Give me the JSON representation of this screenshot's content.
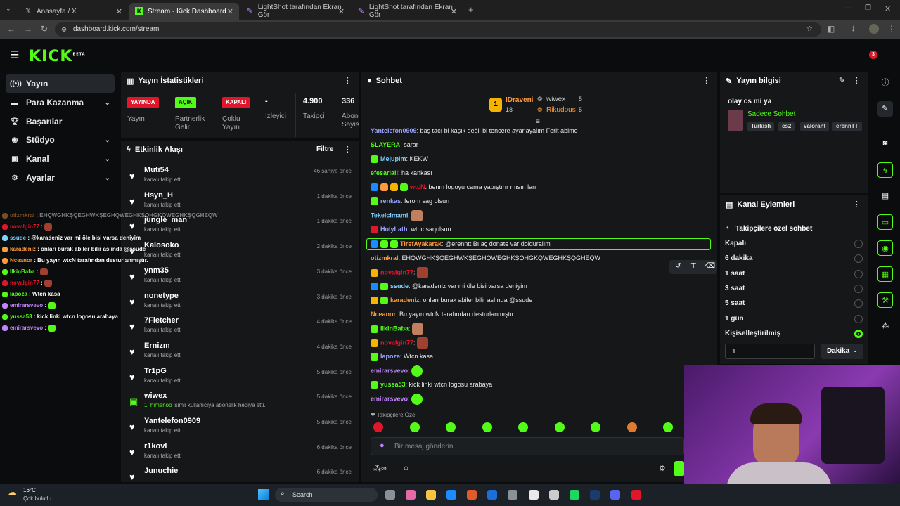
{
  "browser": {
    "tabs": [
      {
        "label": "Anasayfa / X",
        "icon": "x-logo-icon"
      },
      {
        "label": "Stream - Kick Dashboard",
        "icon": "kick-logo-icon"
      },
      {
        "label": "LightShot tarafından Ekran Gör",
        "icon": "lightshot-icon"
      },
      {
        "label": "LightShot tarafından Ekran Gör",
        "icon": "lightshot-icon"
      }
    ],
    "url": "dashboard.kick.com/stream"
  },
  "site": {
    "logo": "KICK",
    "logo_sup": "BETA",
    "notif_count": "3"
  },
  "nav": [
    {
      "label": "Yayın",
      "icon": "broadcast-icon"
    },
    {
      "label": "Para Kazanma",
      "icon": "money-icon"
    },
    {
      "label": "Başarılar",
      "icon": "trophy-icon"
    },
    {
      "label": "Stüdyo",
      "icon": "studio-icon"
    },
    {
      "label": "Kanal",
      "icon": "channel-icon"
    },
    {
      "label": "Ayarlar",
      "icon": "gear-icon"
    }
  ],
  "stats": {
    "title": "Yayın İstatistikleri",
    "badges": [
      {
        "label": "YAYINDA",
        "caption": "Yayın",
        "color": "#e2162b"
      },
      {
        "label": "AÇIK",
        "caption": "Partnerlik Gelir Programı",
        "color": "#53fc18"
      },
      {
        "label": "KAPALI",
        "caption": "Çoklu Yayın",
        "color": "#e2162b"
      }
    ],
    "numbers": [
      {
        "value": "-",
        "caption": "İzleyici"
      },
      {
        "value": "4.900",
        "caption": "Takipçi"
      },
      {
        "value": "336",
        "caption": "Abone Sayısı"
      }
    ]
  },
  "activity": {
    "title": "Etkinlik Akışı",
    "filter": "Filtre",
    "items": [
      {
        "name": "Muti54",
        "action": "kanalı takip etti",
        "time": "46 saniye önce",
        "type": "follow"
      },
      {
        "name": "Hsyn_H",
        "action": "kanalı takip etti",
        "time": "1 dakika önce",
        "type": "follow"
      },
      {
        "name": "jungle_man",
        "action": "kanalı takip etti",
        "time": "1 dakika önce",
        "type": "follow"
      },
      {
        "name": "Kalosoko",
        "action": "kanalı takip etti",
        "time": "2 dakika önce",
        "type": "follow"
      },
      {
        "name": "ynm35",
        "action": "kanalı takip etti",
        "time": "3 dakika önce",
        "type": "follow"
      },
      {
        "name": "nonetype",
        "action": "kanalı takip etti",
        "time": "3 dakika önce",
        "type": "follow"
      },
      {
        "name": "7Fletcher",
        "action": "kanalı takip etti",
        "time": "4 dakika önce",
        "type": "follow"
      },
      {
        "name": "Ernizm",
        "action": "kanalı takip etti",
        "time": "4 dakika önce",
        "type": "follow"
      },
      {
        "name": "Tr1pG",
        "action": "kanalı takip etti",
        "time": "5 dakika önce",
        "type": "follow"
      },
      {
        "name": "wiwex",
        "action": "isimli kullanıcıya abonelik hediye etti.",
        "highlight": "1, himenoo",
        "time": "5 dakika önce",
        "type": "gift"
      },
      {
        "name": "Yantelefon0909",
        "action": "kanalı takip etti",
        "time": "5 dakika önce",
        "type": "follow"
      },
      {
        "name": "r1kovl",
        "action": "kanalı takip etti",
        "time": "6 dakika önce",
        "type": "follow"
      },
      {
        "name": "Junuchie",
        "action": "",
        "time": "6 dakika önce",
        "type": "follow"
      }
    ]
  },
  "chat": {
    "title": "Sohbet",
    "leaderboard": [
      {
        "rank": "1",
        "name": "IDraveni",
        "count": "18"
      },
      {
        "name": "wiwex",
        "count": "5"
      },
      {
        "name": "Rikudous",
        "count": "5"
      }
    ],
    "messages": [
      {
        "user": "Yantelefon0909",
        "color": "#9aa3ff",
        "text": "baş tacı bi kaşık değil bi tencere ayarlayalım Ferit abime"
      },
      {
        "user": "SLAYERA",
        "color": "#53fc18",
        "text": "sarar"
      },
      {
        "user": "Mejupim",
        "color": "#7fd1ff",
        "text": "KEKW"
      },
      {
        "user": "efesariall",
        "color": "#53fc18",
        "text": "ha kankası"
      },
      {
        "user": "wtcN",
        "color": "#e2162b",
        "text": "benm logoyu cama yapıştırır mısın lan"
      },
      {
        "user": "renkas",
        "color": "#9aa3ff",
        "text": "ferom sag olsun"
      },
      {
        "user": "Tekelcimami",
        "color": "#7fd1ff",
        "text": ""
      },
      {
        "user": "HolyLath",
        "color": "#9aa3ff",
        "text": "wtnc saqolsun"
      },
      {
        "user": "TirefAyakarak",
        "color": "#ff9a3c",
        "text": "@erenntt Bı aç donate var dolduralım"
      },
      {
        "user": "otizmkral",
        "color": "#ff9a3c",
        "text": "EHQWGHKŞQEGHWKŞEGHQWEGHKŞQHGKQWEGHKŞQGHEQW"
      },
      {
        "user": "novalgin77",
        "color": "#e2162b",
        "text": ""
      },
      {
        "user": "ssude",
        "color": "#7fd1ff",
        "text": "@karadeniz var mi öle bisi varsa deniyim"
      },
      {
        "user": "karadeniz",
        "color": "#ff9a3c",
        "text": "onları burak abiler bilir aslında @ssude"
      },
      {
        "user": "Nceanor",
        "color": "#ff9a3c",
        "text": "Bu yayın wtcN tarafından desturlanmıştır."
      },
      {
        "user": "IlkinBaba",
        "color": "#53fc18",
        "text": ""
      },
      {
        "user": "novalgin77",
        "color": "#e2162b",
        "text": ""
      },
      {
        "user": "lapoza",
        "color": "#9aa3ff",
        "text": "Wtcn kasa"
      },
      {
        "user": "emirarsvevo",
        "color": "#c084fc",
        "text": ""
      },
      {
        "user": "yussa53",
        "color": "#53fc18",
        "text": "kick linki wtcn logosu arabaya"
      },
      {
        "user": "emirarsvevo",
        "color": "#c084fc",
        "text": ""
      }
    ],
    "followers_only": "Takipçilere Özel",
    "input_placeholder": "Bir mesaj gönderin"
  },
  "overlay": [
    {
      "user": "otizmkral",
      "color": "#ff9a3c",
      "text": "EHQWGHKŞQEGHWKŞEGHQWEGHKŞQHGKQWEGHKŞQGHEQW"
    },
    {
      "user": "novalgin77",
      "color": "#e2162b",
      "text": ""
    },
    {
      "user": "ssude",
      "color": "#7fd1ff",
      "text": "@karadeniz var mi öle bisi varsa deniyim"
    },
    {
      "user": "karadeniz",
      "color": "#ff9a3c",
      "text": "onları burak abiler bilir aslında @ssude"
    },
    {
      "user": "Nceanor",
      "color": "#ff9a3c",
      "text": "Bu yayın wtcN tarafından desturlanmıştır."
    },
    {
      "user": "IlkinBaba",
      "color": "#53fc18",
      "text": ""
    },
    {
      "user": "novalgin77",
      "color": "#e2162b",
      "text": ""
    },
    {
      "user": "lapoza",
      "color": "#53fc18",
      "text": "Wtcn kasa"
    },
    {
      "user": "emirarsvevo",
      "color": "#c084fc",
      "text": ""
    },
    {
      "user": "yussa53",
      "color": "#53fc18",
      "text": "kick linki wtcn logosu arabaya"
    },
    {
      "user": "emirarsvevo",
      "color": "#c084fc",
      "text": ""
    }
  ],
  "stream_info": {
    "title": "Yayın bilgisi",
    "stream_title": "olay cs mi ya",
    "category": "Sadece Sohbet",
    "tags": [
      "Turkish",
      "cs2",
      "valorant",
      "erennTT"
    ]
  },
  "channel_actions": {
    "title": "Kanal Eylemleri",
    "subtitle": "Takipçilere özel sohbet",
    "options": [
      "Kapalı",
      "6 dakika",
      "1 saat",
      "3 saat",
      "5 saat",
      "1 gün",
      "Kişiselleştirilmiş"
    ],
    "selected_index": 6,
    "custom_value": "1",
    "unit": "Dakika"
  },
  "taskbar": {
    "temp": "16°C",
    "weather": "Çok bulutlu",
    "search": "Search"
  }
}
